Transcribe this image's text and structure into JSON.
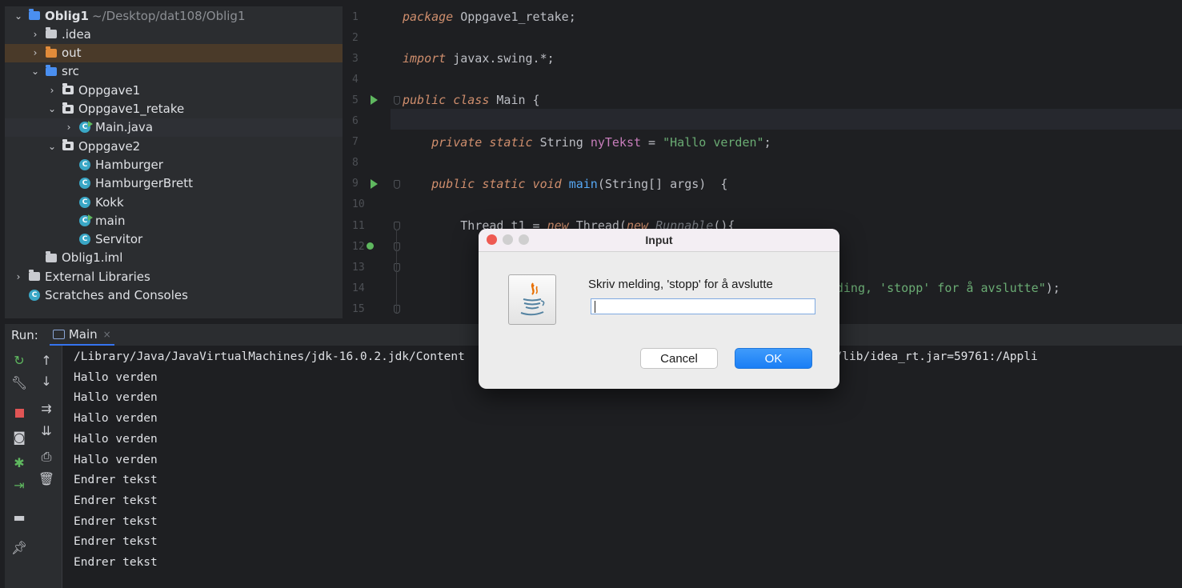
{
  "project_tree": [
    {
      "indent": 0,
      "arrow": "⌄",
      "icon": "module-folder",
      "label": "Oblig1",
      "suffix": "~/Desktop/dat108/Oblig1",
      "bold": true
    },
    {
      "indent": 1,
      "arrow": "›",
      "icon": "folder",
      "label": ".idea"
    },
    {
      "indent": 1,
      "arrow": "›",
      "icon": "folder-orange",
      "label": "out",
      "highlight": "out"
    },
    {
      "indent": 1,
      "arrow": "⌄",
      "icon": "folder-blue",
      "label": "src"
    },
    {
      "indent": 2,
      "arrow": "›",
      "icon": "package",
      "label": "Oppgave1"
    },
    {
      "indent": 2,
      "arrow": "⌄",
      "icon": "package",
      "label": "Oppgave1_retake"
    },
    {
      "indent": 3,
      "arrow": "›",
      "icon": "class-run",
      "label": "Main.java",
      "highlight": "sel"
    },
    {
      "indent": 2,
      "arrow": "⌄",
      "icon": "package",
      "label": "Oppgave2"
    },
    {
      "indent": 3,
      "arrow": "",
      "icon": "class",
      "label": "Hamburger"
    },
    {
      "indent": 3,
      "arrow": "",
      "icon": "class",
      "label": "HamburgerBrett"
    },
    {
      "indent": 3,
      "arrow": "",
      "icon": "class",
      "label": "Kokk"
    },
    {
      "indent": 3,
      "arrow": "",
      "icon": "class-run",
      "label": "main"
    },
    {
      "indent": 3,
      "arrow": "",
      "icon": "class",
      "label": "Servitor"
    },
    {
      "indent": 1,
      "arrow": "",
      "icon": "iml-file",
      "label": "Oblig1.iml"
    },
    {
      "indent": 0,
      "arrow": "›",
      "icon": "libraries",
      "label": "External Libraries"
    },
    {
      "indent": 0,
      "arrow": "",
      "icon": "scratches",
      "label": "Scratches and Consoles"
    }
  ],
  "editor": {
    "line_numbers": [
      "1",
      "2",
      "3",
      "4",
      "5",
      "6",
      "7",
      "8",
      "9",
      "10",
      "11",
      "12",
      "13",
      "14",
      "15"
    ],
    "lines": [
      [
        [
          "kw",
          "package"
        ],
        [
          "cls",
          " Oppgave1_retake;"
        ]
      ],
      [],
      [
        [
          "kw",
          "import"
        ],
        [
          "cls",
          " javax.swing.*;"
        ]
      ],
      [],
      [
        [
          "kw",
          "public class"
        ],
        [
          "cls",
          " Main {"
        ]
      ],
      [],
      [
        [
          "cls",
          "    "
        ],
        [
          "kw",
          "private static"
        ],
        [
          "cls",
          " String "
        ],
        [
          "fld",
          "nyTekst"
        ],
        [
          "cls",
          " = "
        ],
        [
          "str",
          "\"Hallo verden\""
        ],
        [
          "cls",
          ";"
        ]
      ],
      [],
      [
        [
          "cls",
          "    "
        ],
        [
          "kw",
          "public static void"
        ],
        [
          "cls",
          " "
        ],
        [
          "fn",
          "main"
        ],
        [
          "cls",
          "(String[] args)  {"
        ]
      ],
      [],
      [
        [
          "cls",
          "        Thread t1 = "
        ],
        [
          "kw",
          "new"
        ],
        [
          "cls",
          " Thread("
        ],
        [
          "kw",
          "new"
        ],
        [
          "cmt",
          " Runnable"
        ],
        [
          "cls",
          "(){"
        ]
      ],
      [],
      [],
      [
        [
          "cls",
          "                                                    "
        ],
        [
          "str",
          "kriv melding, 'stopp' for å avslutte\""
        ],
        [
          "cls",
          ");"
        ]
      ],
      []
    ]
  },
  "run_panel": {
    "label": "Run:",
    "tab_label": "Main",
    "tab_close": "×",
    "console_lines": [
      "/Library/Java/JavaVirtualMachines/jdk-16.0.2.jdk/Content                                    IDEA.app/Contents/lib/idea_rt.jar=59761:/Appli",
      "Hallo verden",
      "Hallo verden",
      "Hallo verden",
      "Hallo verden",
      "Hallo verden",
      "Endrer tekst",
      "Endrer tekst",
      "Endrer tekst",
      "Endrer tekst",
      "Endrer tekst"
    ]
  },
  "dialog": {
    "title": "Input",
    "message": "Skriv melding, 'stopp' for å avslutte",
    "input_value": "",
    "cancel_label": "Cancel",
    "ok_label": "OK"
  },
  "colors": {
    "accent": "#3574f0",
    "ok_button": "#1a7ef5",
    "close_red": "#ee5a52",
    "traffic_gray": "#c8c8c8"
  }
}
